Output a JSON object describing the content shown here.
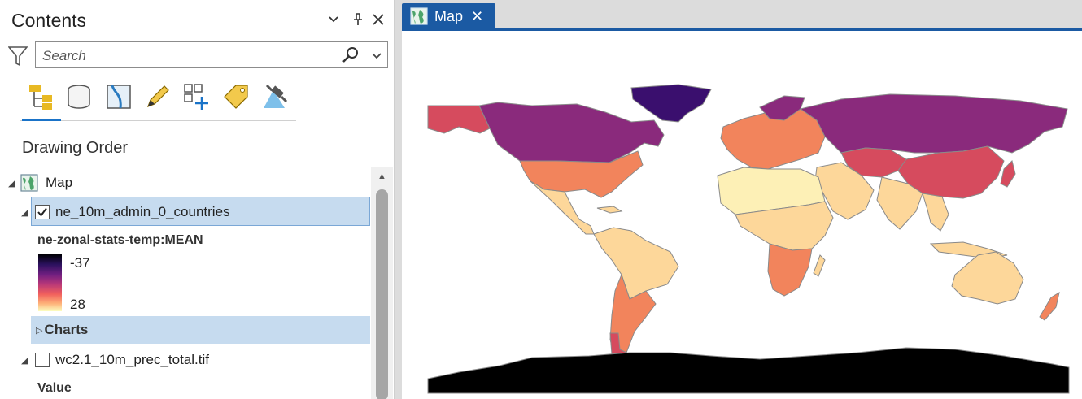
{
  "contents": {
    "title": "Contents",
    "search_placeholder": "Search",
    "toolbar": {
      "buttons": [
        "list-by-drawing-order",
        "list-by-source",
        "list-by-selection",
        "list-by-editing",
        "list-by-snapping",
        "list-by-labeling",
        "list-by-perspective-imagery"
      ]
    },
    "section_heading": "Drawing Order",
    "tree": {
      "map_label": "Map",
      "layer1": {
        "label": "ne_10m_admin_0_countries",
        "checked": true,
        "field": "ne-zonal-stats-temp:MEAN",
        "legend_high": "-37",
        "legend_low": "28",
        "charts_label": "Charts"
      },
      "layer2": {
        "label": "wc2.1_10m_prec_total.tif",
        "checked": false,
        "field": "Value"
      }
    }
  },
  "map_view": {
    "tab_title": "Map",
    "tab_close": "✕",
    "colors": {
      "cold": "#3a0f6e",
      "cool": "#8a2a7c",
      "mid": "#d64b5e",
      "warm": "#f2845c",
      "hot": "#fdd79a",
      "hottest": "#fdf0b6",
      "antarctica": "#000000"
    }
  }
}
